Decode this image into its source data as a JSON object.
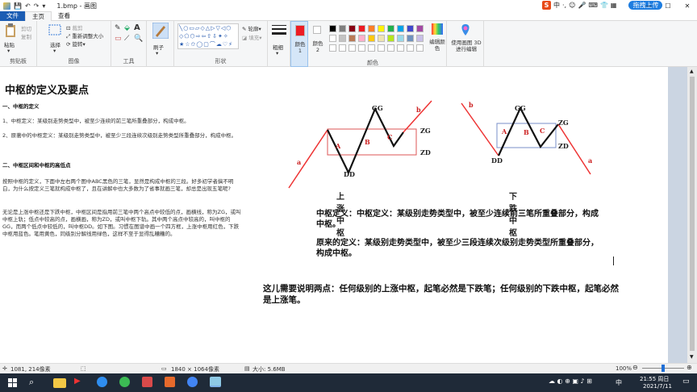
{
  "titlebar": {
    "title": "1.bmp - 画图",
    "quick_access": [
      "💾",
      "↶",
      "↷",
      "▾"
    ],
    "ime": {
      "lang": "中",
      "upload_label": "拖拽上传"
    }
  },
  "tabs": [
    "文件",
    "主页",
    "查看"
  ],
  "ribbon": {
    "clipboard": {
      "paste": "粘贴",
      "cut": "剪切",
      "copy": "复制",
      "label": "剪贴板"
    },
    "image": {
      "select": "选择",
      "crop": "裁剪",
      "resize": "重新调整大小",
      "rotate": "旋转",
      "label": "图像"
    },
    "tools": {
      "label": "工具"
    },
    "brushes": {
      "label": "刷子"
    },
    "shapes": {
      "outline": "轮廓",
      "fill": "填充",
      "label": "形状"
    },
    "size": {
      "label": "粗细"
    },
    "color1": {
      "label": "颜色 1"
    },
    "color2": {
      "label": "颜色 2"
    },
    "colors": {
      "label": "颜色",
      "edit": "编辑颜色"
    },
    "paint3d": {
      "label": "使用画图 3D 进行编辑"
    },
    "palette": [
      "#000000",
      "#7f7f7f",
      "#880015",
      "#ed1c24",
      "#ff7f27",
      "#fff200",
      "#22b14c",
      "#00a2e8",
      "#3f48cc",
      "#a349a4",
      "#ffffff",
      "#c3c3c3",
      "#b97a57",
      "#ffaec9",
      "#ffc90e",
      "#efe4b0",
      "#b5e61d",
      "#99d9ea",
      "#7092be",
      "#c8bfe7"
    ]
  },
  "document": {
    "heading": "中枢的定义及要点",
    "sec1_title": "一、中枢的定义",
    "p1": "1、中枢定义：某级别走势类型中，被至少连续的前三笔所重叠部分，构成中枢。",
    "p2": "2、原著中的中枢定义：某级别走势类型中，被至少三段连续次级别走势类型所重叠部分，构成中枢。",
    "sec2_title": "二、中枢区间和中枢的高低点",
    "p3": "按照中枢的定义，下面中左右两个图中ABC黑色的三笔，显然是构成中枢的三段。好多初学者搞不明白，为什么按定义三笔就构成中枢了，且在讲解中也大多数为了省事就画三笔，却总是出现五笔呢?",
    "p4": "无论是上涨中枢还是下跌中枢，中枢区间是指用前三笔中两个高点中较低的点，画横线，称为ZG，或叫中枢上轨；低点中较高的点，画横画，称为ZD，或叫中枢下轨。其中两个高点中较高的，叫中枢的GG，而两个低点中较低的，叫中枢DD。如下图。习惯在图谱中画一个四方框，上涨中枢用红色，下跌中枢用蓝色。笔用黄色，同级别分解线用绿色，这样不至于显得乱糟糟的。",
    "diagram_labels": {
      "gg": "GG",
      "zg": "ZG",
      "zd": "ZD",
      "dd": "DD",
      "a": "A",
      "b": "B",
      "c": "C",
      "la": "a",
      "lb": "b",
      "up_title": "上涨中枢",
      "down_title": "下跌中枢"
    },
    "def1": "中枢定义：中枢定义：某级别走势类型中，被至少连续前三笔所重叠部分，构成中枢。",
    "def2": "原来的定义：某级别走势类型中，被至少三段连续次级别走势类型所重叠部分，构成中枢。",
    "note": "这儿需要说明两点：任何级别的上涨中枢，起笔必然是下跌笔；任何级别的下跌中枢，起笔必然是上涨笔。"
  },
  "status": {
    "cursor": "1081, 214像素",
    "dimensions": "1840 × 1064像素",
    "filesize": "大小: 5.6MB",
    "zoom": "100%",
    "zoom_level": 0.5
  },
  "taskbar": {
    "time": "21:55 周日",
    "date": "2021/7/11",
    "lang": "中"
  }
}
